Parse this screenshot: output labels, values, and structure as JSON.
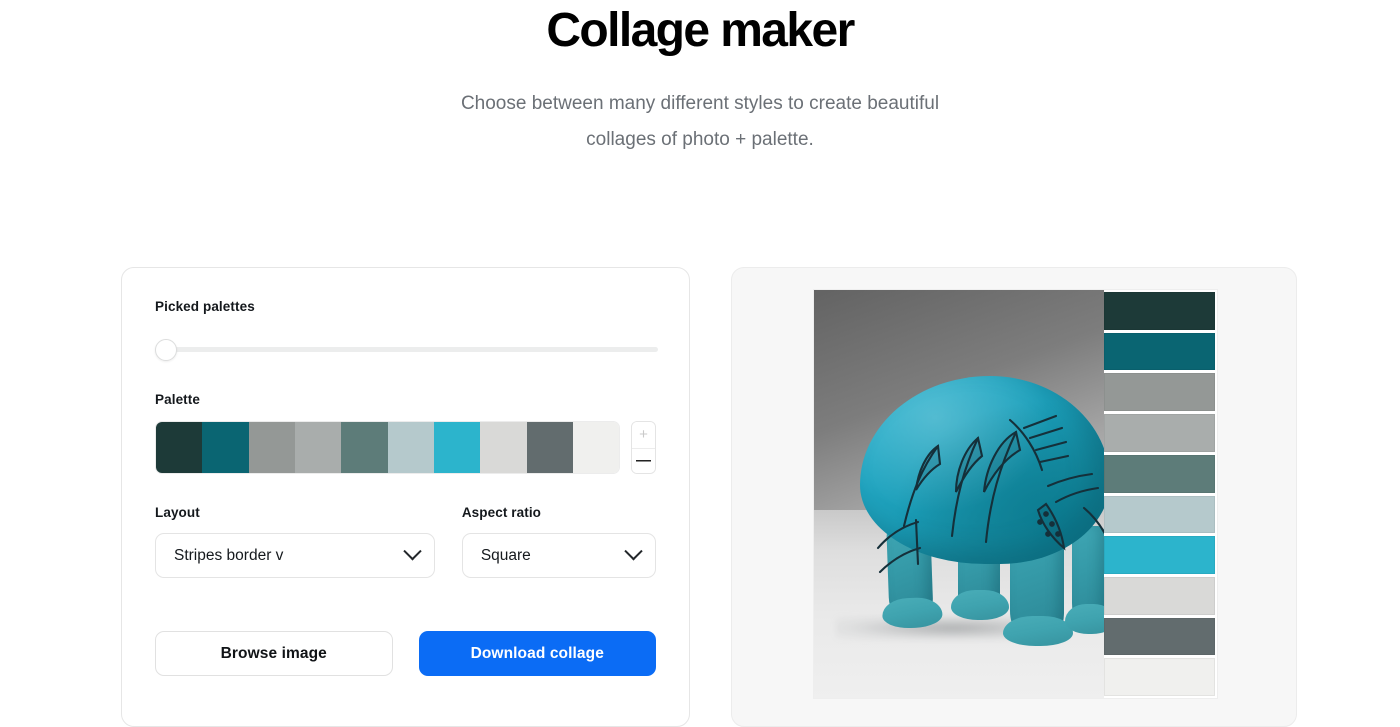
{
  "header": {
    "title": "Collage maker",
    "subtitle": "Choose between many different styles to create beautiful collages of photo + palette."
  },
  "controls": {
    "picked_palettes": {
      "label": "Picked palettes",
      "value": 0,
      "min": 0,
      "max": 100
    },
    "palette": {
      "label": "Palette",
      "swatches": [
        "#1d3a38",
        "#0a6572",
        "#949896",
        "#a9adac",
        "#5d7c79",
        "#b5c9cc",
        "#2cb4cc",
        "#d9d9d7",
        "#626c6e",
        "#f0f0ee"
      ],
      "add_label": "+",
      "remove_label": "—"
    },
    "layout": {
      "label": "Layout",
      "value": "Stripes border v"
    },
    "aspect_ratio": {
      "label": "Aspect ratio",
      "value": "Square"
    },
    "browse_button": "Browse image",
    "download_button": "Download collage",
    "accent_color": "#0b6cf5"
  },
  "preview": {
    "photo_alt": "Turquoise faience hippopotamus figurine with lotus drawings",
    "stripes": [
      "#1d3a38",
      "#0a6572",
      "#949896",
      "#a9adac",
      "#5d7c79",
      "#b5c9cc",
      "#2cb4cc",
      "#d9d9d7",
      "#626c6e",
      "#f0f0ee"
    ]
  }
}
